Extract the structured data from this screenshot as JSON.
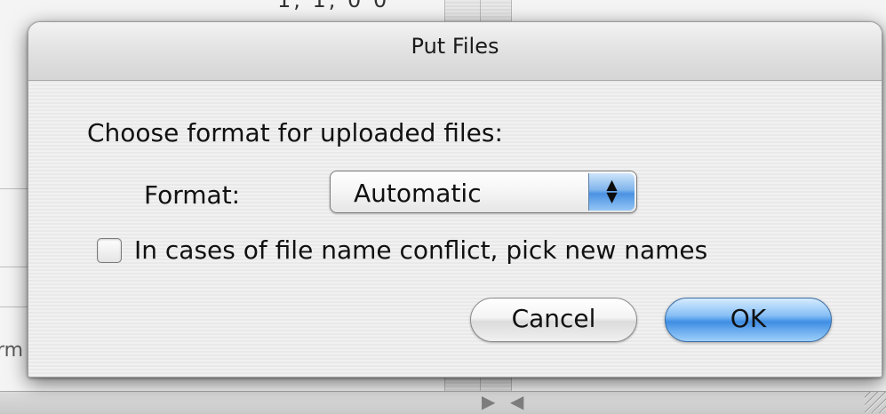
{
  "background": {
    "top_text": "1, 1, 0 0",
    "side_text": "rm",
    "left_arrow": "▶",
    "right_arrow": "◀"
  },
  "dialog": {
    "title": "Put Files",
    "prompt": "Choose format for uploaded files:",
    "format_label": "Format:",
    "format_value": "Automatic",
    "checkbox_label": "In cases of file name conflict, pick new names",
    "checkbox_checked": false,
    "cancel_label": "Cancel",
    "ok_label": "OK"
  },
  "icons": {
    "popup_arrows": "up-down-arrows-icon",
    "checkbox": "checkbox-icon",
    "resize_grip": "resize-grip-icon"
  },
  "colors": {
    "default_button": "#3f8ee4",
    "popup_arrow_accent": "#4a92e2"
  }
}
